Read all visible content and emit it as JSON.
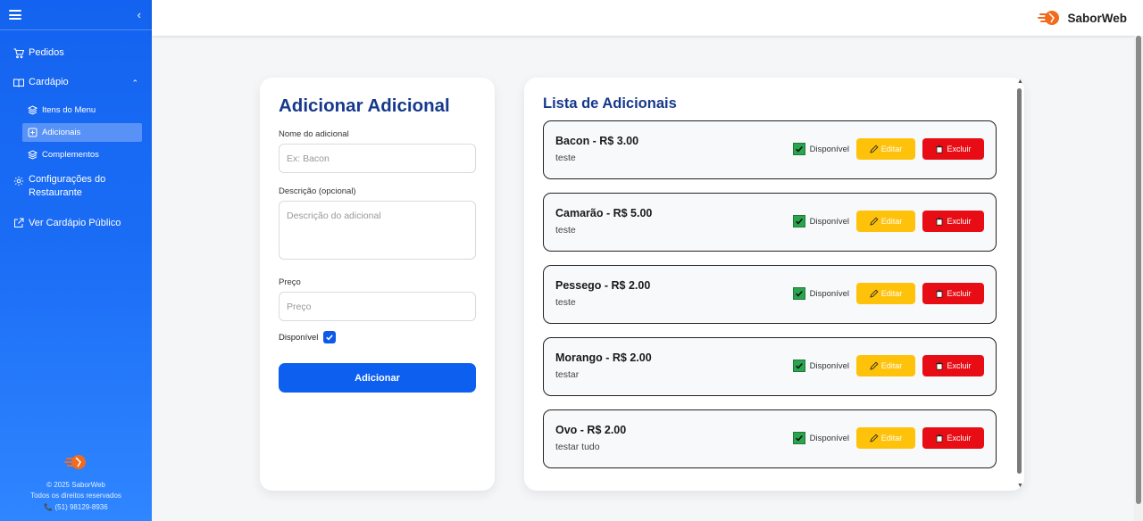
{
  "brand": {
    "name": "SaborWeb"
  },
  "sidebar": {
    "items": [
      {
        "label": "Pedidos",
        "icon": "cart-icon"
      },
      {
        "label": "Cardápio",
        "icon": "book-icon"
      }
    ],
    "submenu": [
      {
        "label": "Itens do Menu",
        "icon": "layers-icon"
      },
      {
        "label": "Adicionais",
        "icon": "plus-square-icon",
        "active": true
      },
      {
        "label": "Complementos",
        "icon": "layers-icon"
      }
    ],
    "config_label": "Configurações do Restaurante",
    "public_label": "Ver Cardápio Público",
    "footer": {
      "copyright": "© 2025 SaborWeb",
      "rights": "Todos os direitos reservados",
      "phone": "(51) 98129-8936"
    }
  },
  "form": {
    "title": "Adicionar Adicional",
    "name_label": "Nome do adicional",
    "name_placeholder": "Ex: Bacon",
    "desc_label": "Descrição (opcional)",
    "desc_placeholder": "Descrição do adicional",
    "price_label": "Preço",
    "price_placeholder": "Preço",
    "available_label": "Disponível",
    "available_checked": true,
    "submit_label": "Adicionar"
  },
  "list": {
    "title": "Lista de Adicionais",
    "available_label": "Disponível",
    "edit_label": "Editar",
    "delete_label": "Excluir",
    "items": [
      {
        "title": "Bacon - R$ 3.00",
        "desc": "teste"
      },
      {
        "title": "Camarão - R$ 5.00",
        "desc": "teste"
      },
      {
        "title": "Pessego - R$ 2.00",
        "desc": "teste"
      },
      {
        "title": "Morango - R$ 2.00",
        "desc": "testar"
      },
      {
        "title": "Ovo - R$ 2.00",
        "desc": "testar tudo"
      }
    ]
  },
  "colors": {
    "sidebar": "#1463f0",
    "primary": "#0d5ff0",
    "title": "#17398c",
    "edit": "#ffc20a",
    "delete": "#e80d15",
    "available": "#2aa44f"
  }
}
